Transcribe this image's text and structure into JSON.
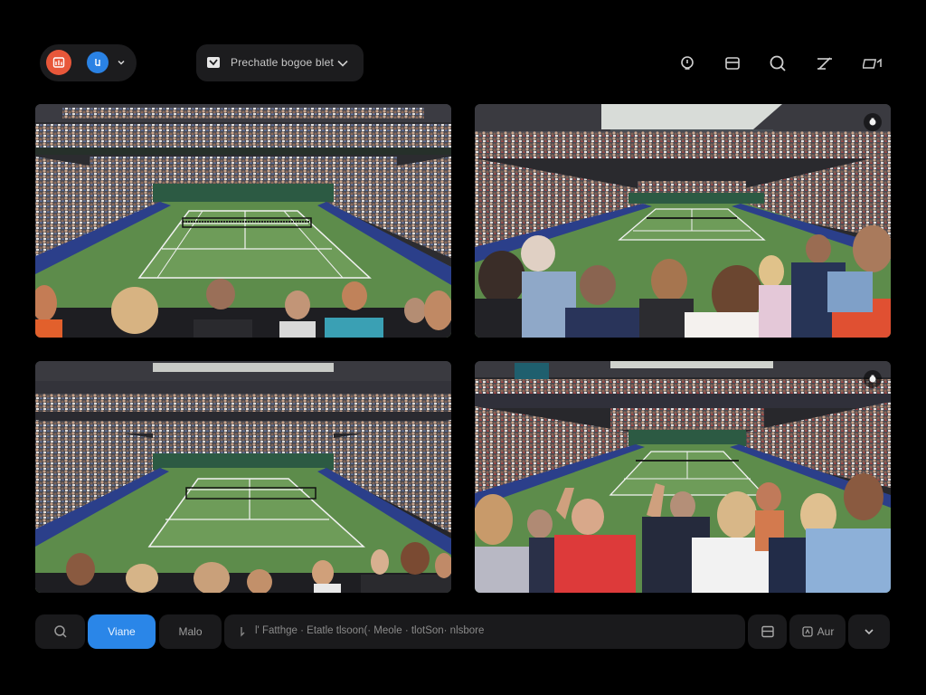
{
  "topbar": {
    "account": {
      "primary_avatar_icon": "image-gallery-icon",
      "secondary_avatar_icon": "share-icon"
    },
    "session_select": {
      "label": "Prechatle bogoe blet",
      "icon": "folder-badge-icon"
    },
    "tools": [
      {
        "name": "zoom-icon"
      },
      {
        "name": "layout-icon"
      },
      {
        "name": "search-icon"
      },
      {
        "name": "edit-icon"
      },
      {
        "name": "camera-icon"
      }
    ]
  },
  "tiles": [
    {
      "name": "tile-1",
      "scene": "Tennis stadium, wide view from upper stands"
    },
    {
      "name": "tile-2",
      "scene": "Tennis stadium, crowd in foreground"
    },
    {
      "name": "tile-3",
      "scene": "Tennis stadium under roof, high angle"
    },
    {
      "name": "tile-4",
      "scene": "Crowd cheering at tennis match"
    }
  ],
  "bottombar": {
    "search_icon": "search-icon",
    "primary_label": "Viane",
    "secondary_label": "Malo",
    "prompt_text": "l' Fatthge  · Etatle tlsoon(· Meole · tlotSon· nlsbore",
    "layout_icon": "layout-icon",
    "attach_label": "Aur",
    "expand_icon": "chevron-down-icon"
  },
  "colors": {
    "background": "#000000",
    "panel": "#1c1c1e",
    "accent": "#2a86e8",
    "avatar_orange": "#e8573a",
    "court_green": "#5d8c4b"
  }
}
